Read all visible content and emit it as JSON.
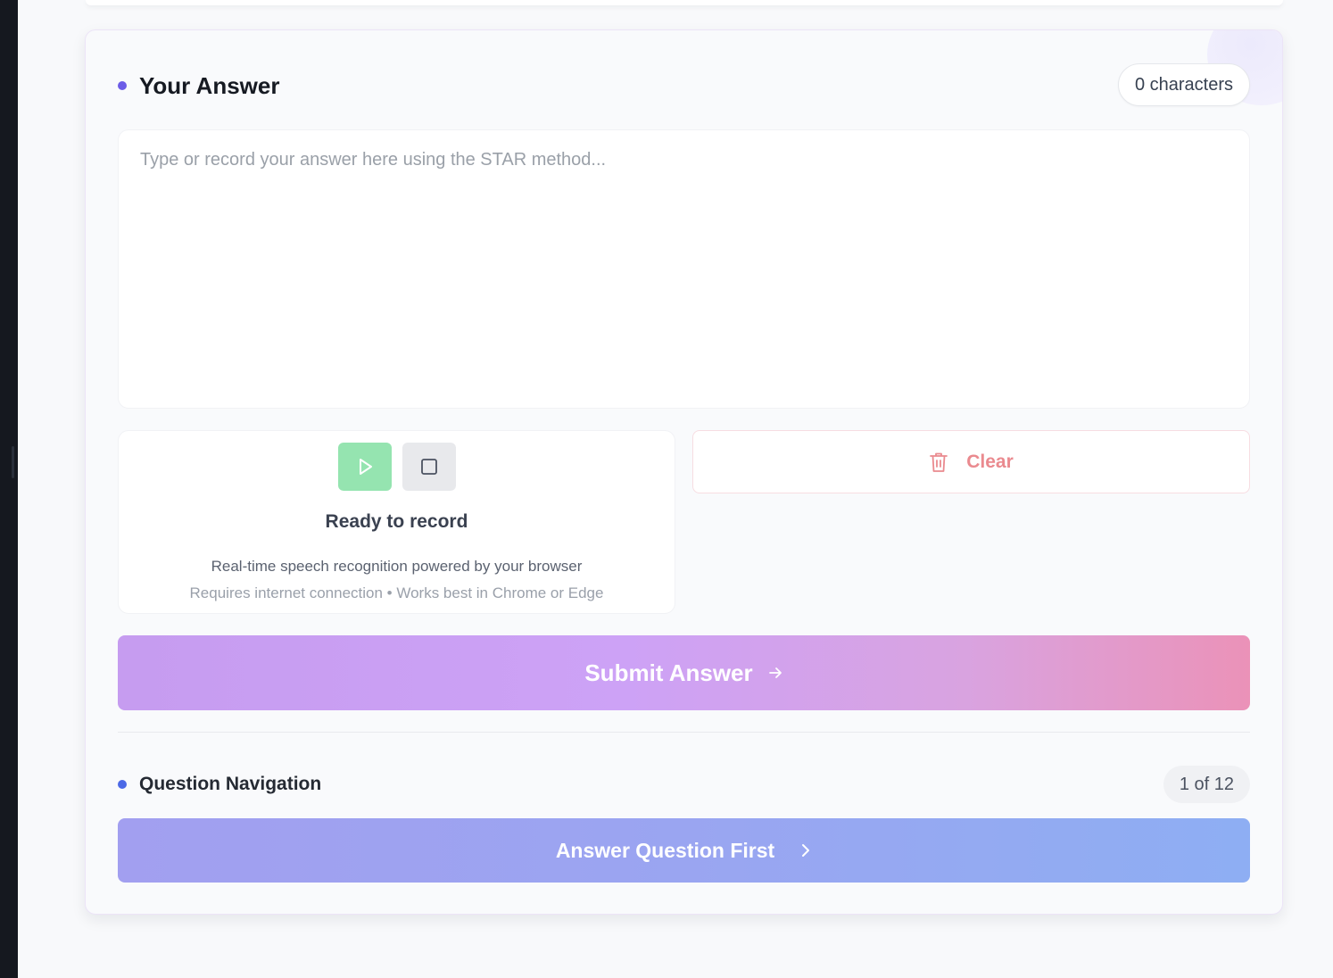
{
  "answer": {
    "title": "Your Answer",
    "char_count": "0 characters",
    "placeholder": "Type or record your answer here using the STAR method...",
    "value": ""
  },
  "recorder": {
    "status": "Ready to record",
    "note_primary": "Real-time speech recognition powered by your browser",
    "note_secondary": "Requires internet connection • Works best in Chrome or Edge"
  },
  "actions": {
    "clear_label": "Clear",
    "submit_label": "Submit Answer"
  },
  "navigation": {
    "title": "Question Navigation",
    "position": "1 of 12",
    "next_label": "Answer Question First"
  },
  "icons": {
    "play": "play-icon",
    "stop": "stop-icon",
    "trash": "trash-icon",
    "submit_arrow": "arrow-right-icon",
    "next_chevron": "chevron-right-icon"
  },
  "colors": {
    "answer_dot": "#6c5ce7",
    "nav_dot": "#4c69e6",
    "play_button": "#95e4b0",
    "clear_text": "#ea8a8f",
    "submit_gradient_start": "#c69cf0",
    "submit_gradient_end": "#eb92b8",
    "next_gradient_start": "#a29ff0",
    "next_gradient_end": "#8eaef3"
  }
}
